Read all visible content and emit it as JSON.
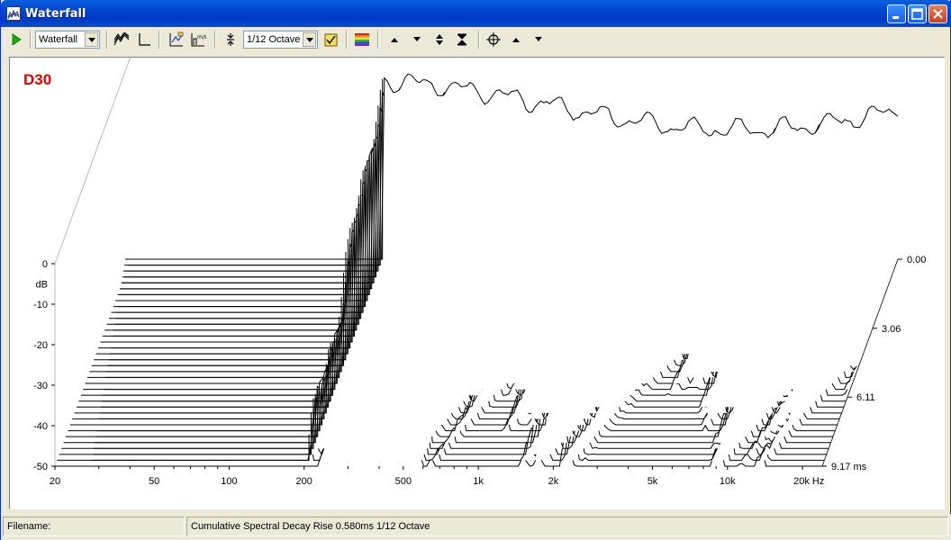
{
  "window": {
    "title": "Waterfall",
    "icon": "waterfall-app-icon",
    "controls": [
      "minimize-icon",
      "maximize-icon",
      "close-icon"
    ]
  },
  "toolbar": {
    "run_icon": "play-icon",
    "view_combo": "Waterfall",
    "icons_group1": [
      "waterfall-icon",
      "axes-icon"
    ],
    "icons_group2": [
      "chart-options-icon",
      "units-icon"
    ],
    "smoothing_icon": "compress-icon",
    "smoothing_combo": "1/12 Octave",
    "settings_icon": "checklist-icon",
    "colour_icon": "rainbow-icon",
    "scale_icons": [
      "arrow-up-icon",
      "arrow-down-icon",
      "expand-icon",
      "collapse-icon"
    ],
    "cursor_icons": [
      "crosshair-icon",
      "arrow-up-icon",
      "arrow-down-icon"
    ]
  },
  "plot": {
    "label": "D30",
    "label_color": "#e00000",
    "y_unit": "dB",
    "x_unit": "Hz",
    "time_unit": "ms"
  },
  "chart_data": {
    "type": "line",
    "chart_kind": "waterfall (cumulative spectral decay)",
    "x_scale": "log",
    "xlim": [
      20,
      24000
    ],
    "x_ticks": [
      {
        "value": 20,
        "label": "20"
      },
      {
        "value": 50,
        "label": "50"
      },
      {
        "value": 100,
        "label": "100"
      },
      {
        "value": 200,
        "label": "200"
      },
      {
        "value": 500,
        "label": "500"
      },
      {
        "value": 1000,
        "label": "1k"
      },
      {
        "value": 2000,
        "label": "2k"
      },
      {
        "value": 5000,
        "label": "5k"
      },
      {
        "value": 10000,
        "label": "10k"
      },
      {
        "value": 20000,
        "label": "20k Hz"
      }
    ],
    "ylim": [
      -50,
      0
    ],
    "y_ticks": [
      {
        "value": 0,
        "label": "0"
      },
      {
        "value": -10,
        "label": "-10"
      },
      {
        "value": -20,
        "label": "-20"
      },
      {
        "value": -30,
        "label": "-30"
      },
      {
        "value": -40,
        "label": "-40"
      },
      {
        "value": -50,
        "label": "-50"
      }
    ],
    "ylabel": "dB",
    "zlim": [
      0,
      9.17
    ],
    "z_ticks": [
      {
        "value": 0,
        "label": "0.00"
      },
      {
        "value": 3.06,
        "label": "3.06"
      },
      {
        "value": 6.11,
        "label": "6.11"
      },
      {
        "value": 9.17,
        "label": "9.17 ms"
      }
    ],
    "slice_count": 36,
    "grid": false,
    "legend": "none",
    "line_color": "#000000"
  },
  "status": {
    "filename_label": "Filename:",
    "description": "Cumulative Spectral Decay   Rise 0.580ms   1/12 Octave"
  }
}
